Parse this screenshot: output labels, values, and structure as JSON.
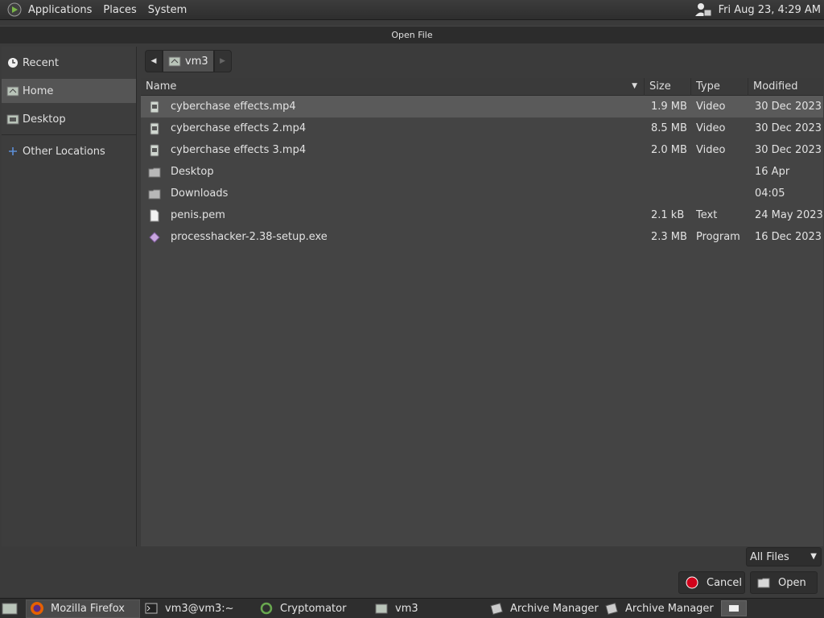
{
  "top_panel": {
    "menus": [
      "Applications",
      "Places",
      "System"
    ],
    "clock": "Fri Aug 23,  4:29 AM"
  },
  "dialog": {
    "title": "Open File",
    "places": [
      {
        "label": "Recent",
        "icon": "recent-icon"
      },
      {
        "label": "Home",
        "icon": "home-folder-icon",
        "selected": true
      },
      {
        "label": "Desktop",
        "icon": "desktop-folder-icon"
      },
      {
        "label": "Other Locations",
        "icon": "plus-icon"
      }
    ],
    "path": {
      "current": "vm3"
    },
    "columns": {
      "name": "Name",
      "size": "Size",
      "type": "Type",
      "modified": "Modified"
    },
    "files": [
      {
        "name": "cyberchase effects.mp4",
        "size": "1.9 MB",
        "type": "Video",
        "modified": "30 Dec 2023",
        "icon": "video-file-icon",
        "selected": true
      },
      {
        "name": "cyberchase effects 2.mp4",
        "size": "8.5 MB",
        "type": "Video",
        "modified": "30 Dec 2023",
        "icon": "video-file-icon"
      },
      {
        "name": "cyberchase effects 3.mp4",
        "size": "2.0 MB",
        "type": "Video",
        "modified": "30 Dec 2023",
        "icon": "video-file-icon"
      },
      {
        "name": "Desktop",
        "size": "",
        "type": "",
        "modified": "16 Apr",
        "icon": "folder-icon"
      },
      {
        "name": "Downloads",
        "size": "",
        "type": "",
        "modified": "04:05",
        "icon": "folder-icon"
      },
      {
        "name": "penis.pem",
        "size": "2.1 kB",
        "type": "Text",
        "modified": "24 May 2023",
        "icon": "text-file-icon"
      },
      {
        "name": "processhacker-2.38-setup.exe",
        "size": "2.3 MB",
        "type": "Program",
        "modified": "16 Dec 2023",
        "icon": "executable-file-icon"
      }
    ],
    "filter": "All Files",
    "cancel_label": "Cancel",
    "open_label": "Open"
  },
  "taskbar": {
    "tasks": [
      {
        "label": "Mozilla Firefox",
        "icon": "firefox-icon",
        "active": true
      },
      {
        "label": "vm3@vm3:~",
        "icon": "terminal-icon"
      },
      {
        "label": "Cryptomator",
        "icon": "cryptomator-icon"
      },
      {
        "label": "vm3",
        "icon": "folder-icon"
      },
      {
        "label": "Archive Manager",
        "icon": "archive-icon"
      },
      {
        "label": "Archive Manager",
        "icon": "archive-icon"
      }
    ]
  },
  "colors": {
    "panel_bg": "#2e2e2e",
    "dialog_bg": "#3b3b3b",
    "list_bg": "#444444",
    "selected_row": "#5a5a5a",
    "cancel_red": "#d0021b"
  }
}
